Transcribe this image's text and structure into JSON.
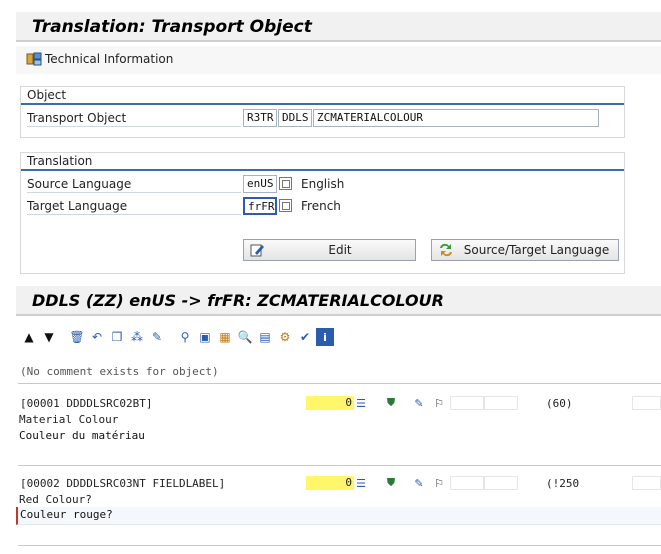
{
  "title": "Translation: Transport Object",
  "toolbar": {
    "technical_info": "Technical Information"
  },
  "object_group": {
    "title": "Object",
    "transport_object_label": "Transport Object",
    "pgmid": "R3TR",
    "object_type": "DDLS",
    "object_name": "ZCMATERIALCOLOUR"
  },
  "translation_group": {
    "title": "Translation",
    "source_label": "Source Language",
    "source_value": "enUS",
    "source_text": "English",
    "target_label": "Target Language",
    "target_value": "frFR",
    "target_text": "French",
    "edit_button": "Edit",
    "swap_button": "Source/Target Language"
  },
  "editor_title": "DDLS (ZZ) enUS -> frFR: ZCMATERIALCOLOUR",
  "comment": "(No comment exists for object)",
  "entries": [
    {
      "header": "[00001  DDDDLSRC02BT]",
      "count": "0",
      "length": "(60)",
      "source": "Material Colour",
      "target": "Couleur du matériau"
    },
    {
      "header": "[00002  DDDDLSRC03NT FIELDLABEL]",
      "count": "0",
      "length": "(!250",
      "source": "Red Colour?",
      "target": "Couleur rouge?"
    }
  ]
}
